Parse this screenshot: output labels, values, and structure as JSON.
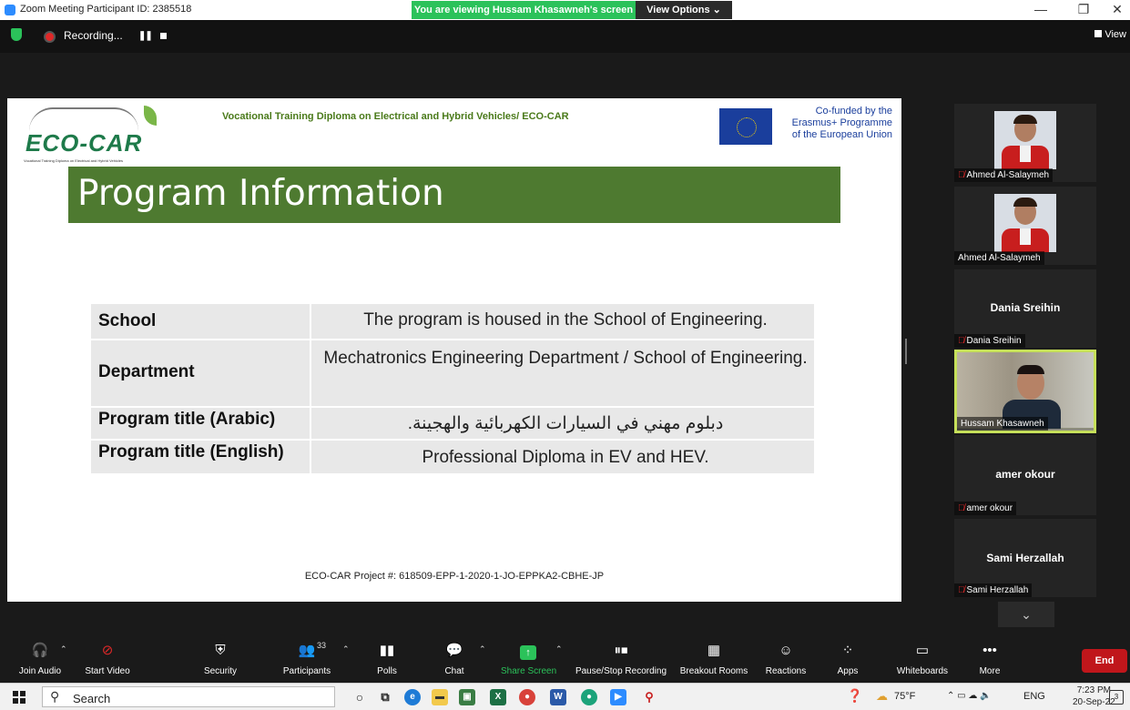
{
  "window": {
    "title": "Zoom Meeting Participant ID: 2385518",
    "banner_text": "You are viewing Hussam Khasawneh's screen",
    "view_options": "View Options ⌄",
    "minimize": "—",
    "restore": "❐",
    "close": "✕"
  },
  "recording": {
    "status": "Recording...",
    "pause_glyph": "❚❚",
    "view_label": "View"
  },
  "slide": {
    "logo_word": "ECO-CAR",
    "logo_tagline": "Vocational Training Diploma on Electrical and Hybrid Vehicles",
    "header": "Vocational Training Diploma on Electrical and Hybrid Vehicles/ ECO-CAR",
    "eu_line1": "Co-funded by the",
    "eu_line2": "Erasmus+ Programme",
    "eu_line3": "of the European Union",
    "banner_title": "Program Information",
    "rows": [
      {
        "label": "School",
        "value": "The program is housed in the School of Engineering."
      },
      {
        "label": "Department",
        "value": "Mechatronics Engineering Department / School of Engineering."
      },
      {
        "label": "Program title (Arabic)",
        "value": "دبلوم مهني في السيارات الكهربائية والهجينة."
      },
      {
        "label": "Program title (English)",
        "value": "Professional Diploma in EV and HEV."
      }
    ],
    "footer": "ECO-CAR Project #: 618509-EPP-1-2020-1-JO-EPPKA2-CBHE-JP"
  },
  "participants": [
    {
      "name": "Ahmed Al-Salaymeh",
      "muted": true,
      "video": "photo"
    },
    {
      "name": "Ahmed Al-Salaymeh",
      "muted": false,
      "video": "photo"
    },
    {
      "name": "Dania Sreihin",
      "muted": true,
      "video": "off"
    },
    {
      "name": "Hussam Khasawneh",
      "muted": false,
      "video": "camera"
    },
    {
      "name": "amer okour",
      "muted": true,
      "video": "off"
    },
    {
      "name": "Sami Herzallah",
      "muted": true,
      "video": "off"
    }
  ],
  "toolbar": {
    "join_audio": "Join Audio",
    "start_video": "Start Video",
    "security": "Security",
    "participants": "Participants",
    "participants_count": "33",
    "polls": "Polls",
    "chat": "Chat",
    "share_screen": "Share Screen",
    "pause_stop": "Pause/Stop Recording",
    "breakout": "Breakout Rooms",
    "reactions": "Reactions",
    "apps": "Apps",
    "whiteboards": "Whiteboards",
    "more": "More",
    "end": "End"
  },
  "taskbar": {
    "search": "Search",
    "temperature": "75°F",
    "language": "ENG",
    "time": "7:23 PM",
    "date": "20-Sep-22",
    "notif_count": "3"
  },
  "colors": {
    "zoom_blue": "#2d8cff",
    "share_green": "#2bc25a",
    "slide_banner": "#4e7a30",
    "end_red": "#c0161b",
    "active_speaker": "#c6e05a"
  }
}
